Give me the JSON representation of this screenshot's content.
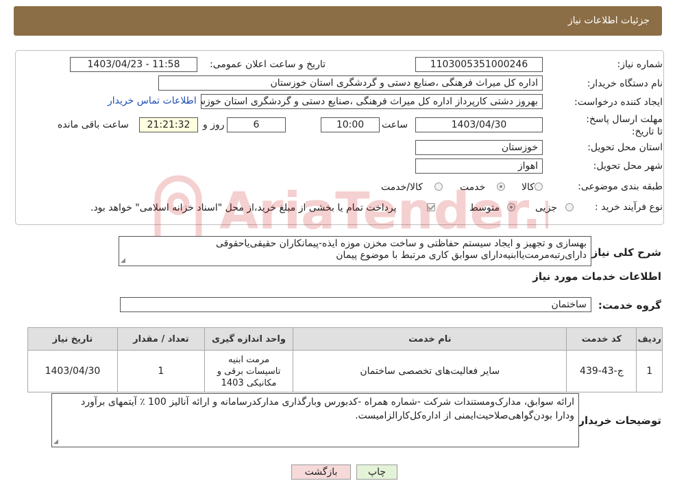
{
  "header": {
    "title": "جزئیات اطلاعات نیاز"
  },
  "form": {
    "need_number_label": "شماره نیاز:",
    "need_number": "1103005351000246",
    "announce_label": "تاریخ و ساعت اعلان عمومی:",
    "announce_value": "1403/04/23 - 11:58",
    "buyer_org_label": "نام دستگاه خریدار:",
    "buyer_org": "اداره کل میراث فرهنگی ،صنایع دستی و گردشگری استان خوزستان",
    "requester_label": "ایجاد کننده درخواست:",
    "requester": "بهروز دشتی کارپرداز اداره کل میراث فرهنگی ،صنایع دستی و گردشگری استان خوزستان",
    "contact_link": "اطلاعات تماس خریدار",
    "deadline_label": "مهلت ارسال پاسخ: تا تاریخ:",
    "deadline_date": "1403/04/30",
    "time_label": "ساعت",
    "deadline_time": "10:00",
    "days_value": "6",
    "days_label": "روز و",
    "remaining_time": "21:21:32",
    "remaining_label": "ساعت باقی مانده",
    "province_label": "استان محل تحویل:",
    "province": "خوزستان",
    "city_label": "شهر محل تحویل:",
    "city": "اهواز",
    "category_label": "طبقه بندی موضوعی:",
    "category_options": [
      {
        "label": "کالا",
        "selected": false
      },
      {
        "label": "خدمت",
        "selected": true
      },
      {
        "label": "کالا/خدمت",
        "selected": false
      }
    ],
    "purchase_type_label": "نوع فرآیند خرید :",
    "purchase_options": [
      {
        "label": "جزیی",
        "selected": false
      },
      {
        "label": "متوسط",
        "selected": true
      }
    ],
    "payment_note": "پرداخت تمام یا بخشی از مبلغ خرید،از محل \"اسناد خزانه اسلامی\" خواهد بود."
  },
  "summary": {
    "label": "شرح کلی نیاز:",
    "text_line1": "بهسازی و تجهیز و ایجاد سیستم حفاظتی و ساخت مخزن موزه ایذه-پیمانکاران حقیقی‌یاحقوقی",
    "text_line2": "دارای‌رتبه‌مرمت‌یاابنیه‌دارای سوابق کاری مرتبط با موضوع پیمان"
  },
  "services": {
    "section_title": "اطلاعات خدمات مورد نیاز",
    "group_label": "گروه خدمت:",
    "group_value": "ساختمان",
    "columns": [
      "ردیف",
      "کد خدمت",
      "نام خدمت",
      "واحد اندازه گیری",
      "تعداد / مقدار",
      "تاریخ نیاز"
    ],
    "rows": [
      {
        "index": "1",
        "code": "ج-43-439",
        "name": "سایر فعالیت‌های تخصصی ساختمان",
        "unit": "مرمت ابنیه تاسیسات برقی و مکانیکی 1403",
        "qty": "1",
        "date": "1403/04/30"
      }
    ]
  },
  "buyer_notes": {
    "label": "توضیحات خریدار:",
    "line1": "ارائه سوابق، مدارک‌ومستندات شرکت -شماره همراه -کدبورس وبارگذاری مدارکدرسامانه و ارائه آنالیز 100 ٪ آیتمهای برآورد",
    "line2": "ودارا بودن‌گواهی‌صلاحیت‌ایمنی از اداره‌کل‌کارالزامیست."
  },
  "buttons": {
    "print": "چاپ",
    "back": "بازگشت"
  },
  "watermark": {
    "text": "AriaTender.neT"
  },
  "colors": {
    "header_bg": "#8c6e46",
    "back_button_bg": "#f6d9d9",
    "print_button_bg": "#e4f3d8",
    "link": "#1f4fb5"
  }
}
